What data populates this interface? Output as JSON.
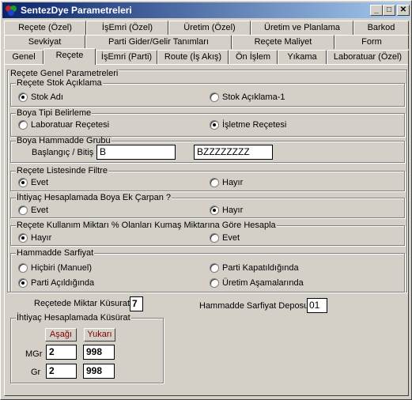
{
  "window": {
    "title": "SentezDye Parametreleri",
    "min": "_",
    "max": "□",
    "close": "✕"
  },
  "tabs_row1": [
    "Reçete (Özel)",
    "İşEmri (Özel)",
    "Üretim (Özel)",
    "Üretim ve Planlama",
    "Barkod"
  ],
  "tabs_row2": [
    "Sevkiyat",
    "Parti Gider/Gelir Tanımları",
    "Reçete Maliyet",
    "Form"
  ],
  "tabs_row3": [
    "Genel",
    "Reçete",
    "İşEmri (Parti)",
    "Route (İş Akış)",
    "Ön İşlem",
    "Yıkama",
    "Laboratuar (Özel)"
  ],
  "outer_group_label": "Reçete Genel Parametreleri",
  "stok_aciklama": {
    "label": "Reçete Stok Açıklama",
    "opt1": "Stok Adı",
    "opt2": "Stok Açıklama-1",
    "selected": 1
  },
  "boya_tipi": {
    "label": "Boya Tipi Belirleme",
    "opt1": "Laboratuar Reçetesi",
    "opt2": "İşletme Reçetesi",
    "selected": 2
  },
  "hammadde_grubu": {
    "label": "Boya Hammadde Grubu",
    "range_label": "Başlangıç / Bitiş",
    "start": "B",
    "end": "BZZZZZZZZ"
  },
  "liste_filtre": {
    "label": "Reçete Listesinde Filtre",
    "opt1": "Evet",
    "opt2": "Hayır",
    "selected": 1
  },
  "ek_carpan": {
    "label": "İhtiyaç Hesaplamada Boya Ek Çarpan ?",
    "opt1": "Evet",
    "opt2": "Hayır",
    "selected": 2
  },
  "kullanim_miktari": {
    "label": "Reçete Kullanım Miktarı % Olanları Kumaş Miktarına Göre Hesapla",
    "opt1": "Hayır",
    "opt2": "Evet",
    "selected": 1
  },
  "sarfiyat": {
    "label": "Hammadde Sarfiyat",
    "opt1": "Hiçbiri (Manuel)",
    "opt2": "Parti Kapatıldığında",
    "opt3": "Parti Açıldığında",
    "opt4": "Üretim Aşamalarında",
    "selected": 3
  },
  "miktar_kusurat": {
    "label": "Reçetede Miktar Küsurat",
    "value": "7"
  },
  "sarfiyat_deposu": {
    "label": "Hammadde Sarfiyat Deposu",
    "value": "01"
  },
  "ihtiyac_kusurat": {
    "label": "İhtiyaç Hesaplamada Küsürat",
    "asagi": "Aşağı",
    "yukari": "Yukarı",
    "mgr_label": "MGr",
    "mgr_asagi": "2",
    "mgr_yukari": "998",
    "gr_label": "Gr",
    "gr_asagi": "2",
    "gr_yukari": "998"
  }
}
